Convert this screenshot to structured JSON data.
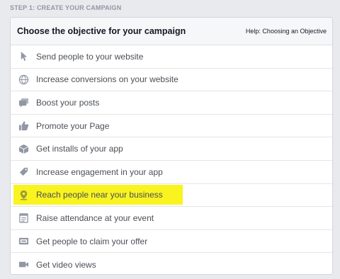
{
  "step": "STEP 1: CREATE YOUR CAMPAIGN",
  "header": {
    "title": "Choose the objective for your campaign",
    "help": "Help: Choosing an Objective"
  },
  "objectives": [
    {
      "label": "Send people to your website",
      "icon": "cursor-icon"
    },
    {
      "label": "Increase conversions on your website",
      "icon": "globe-icon"
    },
    {
      "label": "Boost your posts",
      "icon": "posts-icon"
    },
    {
      "label": "Promote your Page",
      "icon": "thumbs-up-icon"
    },
    {
      "label": "Get installs of your app",
      "icon": "box-icon"
    },
    {
      "label": "Increase engagement in your app",
      "icon": "tag-icon"
    },
    {
      "label": "Reach people near your business",
      "icon": "map-pin-icon",
      "highlighted": true
    },
    {
      "label": "Raise attendance at your event",
      "icon": "calendar-icon"
    },
    {
      "label": "Get people to claim your offer",
      "icon": "offer-icon"
    },
    {
      "label": "Get video views",
      "icon": "video-icon"
    }
  ],
  "colors": {
    "background": "#e9eaed",
    "highlight": "#f9f320",
    "icon": "#9197a3"
  }
}
